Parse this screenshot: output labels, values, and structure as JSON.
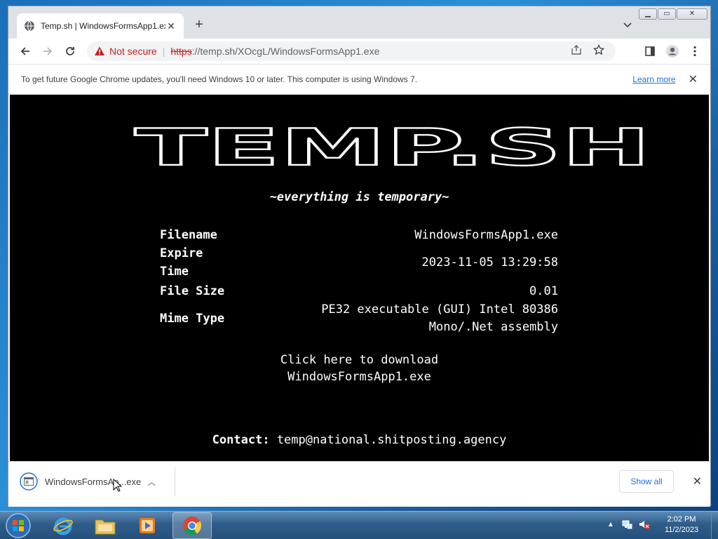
{
  "browser": {
    "tab": {
      "title": "Temp.sh | WindowsFormsApp1.exe"
    },
    "address": {
      "security_label": "Not secure",
      "scheme": "https",
      "rest": "://temp.sh/XOcgL/WindowsFormsApp1.exe"
    },
    "infobar": {
      "message": "To get future Google Chrome updates, you'll need Windows 10 or later. This computer is using Windows 7.",
      "link": "Learn more"
    }
  },
  "page": {
    "logo_text": "TEMP.SH",
    "tagline": "~everything is temporary~",
    "meta": [
      {
        "key": "Filename",
        "value": "WindowsFormsApp1.exe"
      },
      {
        "key": "Expire",
        "key2": "Time",
        "value": "2023-11-05 13:29:58"
      },
      {
        "key": "File Size",
        "value": "0.01"
      },
      {
        "key": "Mime Type",
        "value": "PE32 executable (GUI) Intel 80386",
        "value2": "Mono/.Net assembly"
      }
    ],
    "download_line1": "Click here to download",
    "download_line2": "WindowsFormsApp1.exe",
    "contact_label": "Contact:",
    "contact_email": "temp@national.shitposting.agency"
  },
  "download_shelf": {
    "file_name": "WindowsFormsAp...exe",
    "show_all": "Show all"
  },
  "taskbar": {
    "time": "2:02 PM",
    "date": "11/2/2023"
  },
  "colors": {
    "page_bg": "#000000",
    "page_text": "#ffffff",
    "link": "#1a73e8",
    "insecure": "#c5221f"
  }
}
